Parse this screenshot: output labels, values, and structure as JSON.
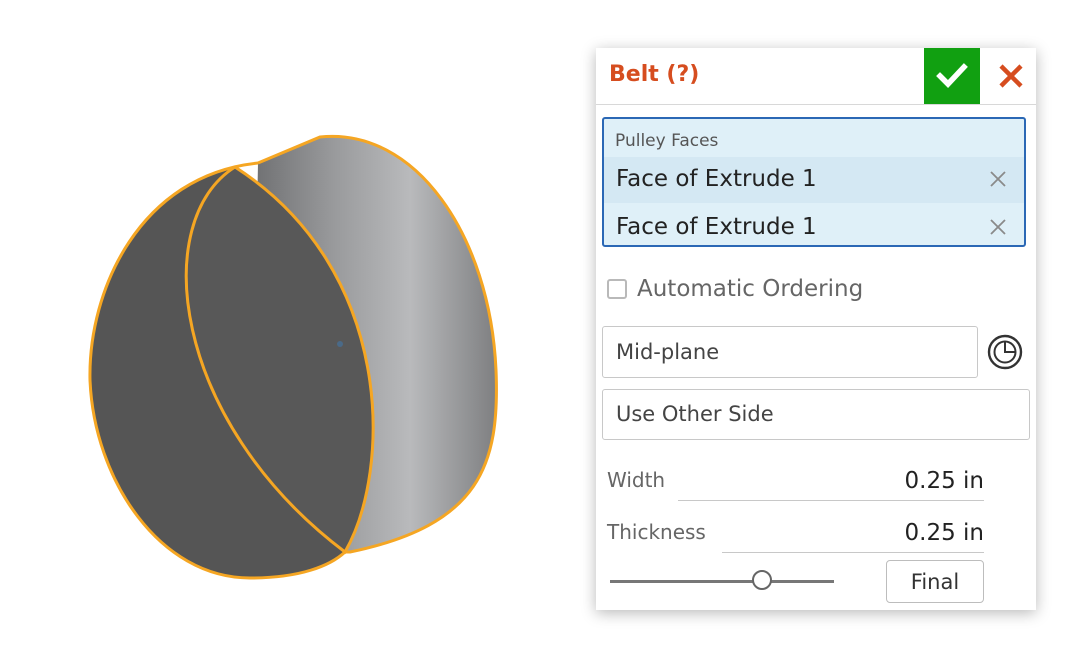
{
  "dialog": {
    "title": "Belt (?)",
    "ok_icon": "checkmark-icon",
    "cancel_icon": "close-icon",
    "accent_title": "#d64d1f",
    "accent_ok": "#11a011",
    "accent_selection": "#2b68b5"
  },
  "pulley_faces": {
    "label": "Pulley Faces",
    "items": [
      {
        "label": "Face of Extrude 1",
        "remove_icon": "close-icon"
      },
      {
        "label": "Face of Extrude 1",
        "remove_icon": "close-icon"
      }
    ]
  },
  "automatic_ordering": {
    "label": "Automatic Ordering",
    "checked": false
  },
  "end_type": {
    "selected": "Mid-plane",
    "icon": "mid-plane-icon"
  },
  "use_other_side": {
    "label": "Use Other Side"
  },
  "width": {
    "label": "Width",
    "value": "0.25 in"
  },
  "thickness": {
    "label": "Thickness",
    "value": "0.25 in"
  },
  "rollback": {
    "position": 0.68,
    "final_label": "Final"
  },
  "viewport": {
    "highlight_color": "#f5a623",
    "part": "extruded-cylinder"
  }
}
